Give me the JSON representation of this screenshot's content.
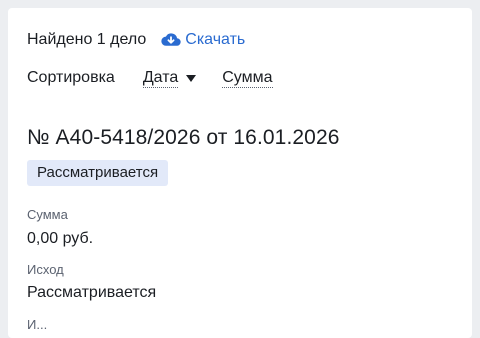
{
  "results": {
    "found_text": "Найдено 1 дело",
    "download_label": "Скачать",
    "download_icon": "cloud-download-icon"
  },
  "sorting": {
    "label": "Сортировка",
    "options": [
      {
        "label": "Дата",
        "active": true,
        "direction_icon": "caret-down-icon"
      },
      {
        "label": "Сумма",
        "active": false
      }
    ]
  },
  "case": {
    "title": "№ А40-5418/2026 от 16.01.2026",
    "status": "Рассматривается",
    "fields": [
      {
        "label": "Сумма",
        "value": "0,00 руб."
      },
      {
        "label": "Исход",
        "value": "Рассматривается"
      }
    ],
    "next_label_partial": "И..."
  },
  "colors": {
    "link": "#2a6bd0",
    "badge_bg": "#e2e9f9",
    "page_bg": "#eceef1"
  }
}
